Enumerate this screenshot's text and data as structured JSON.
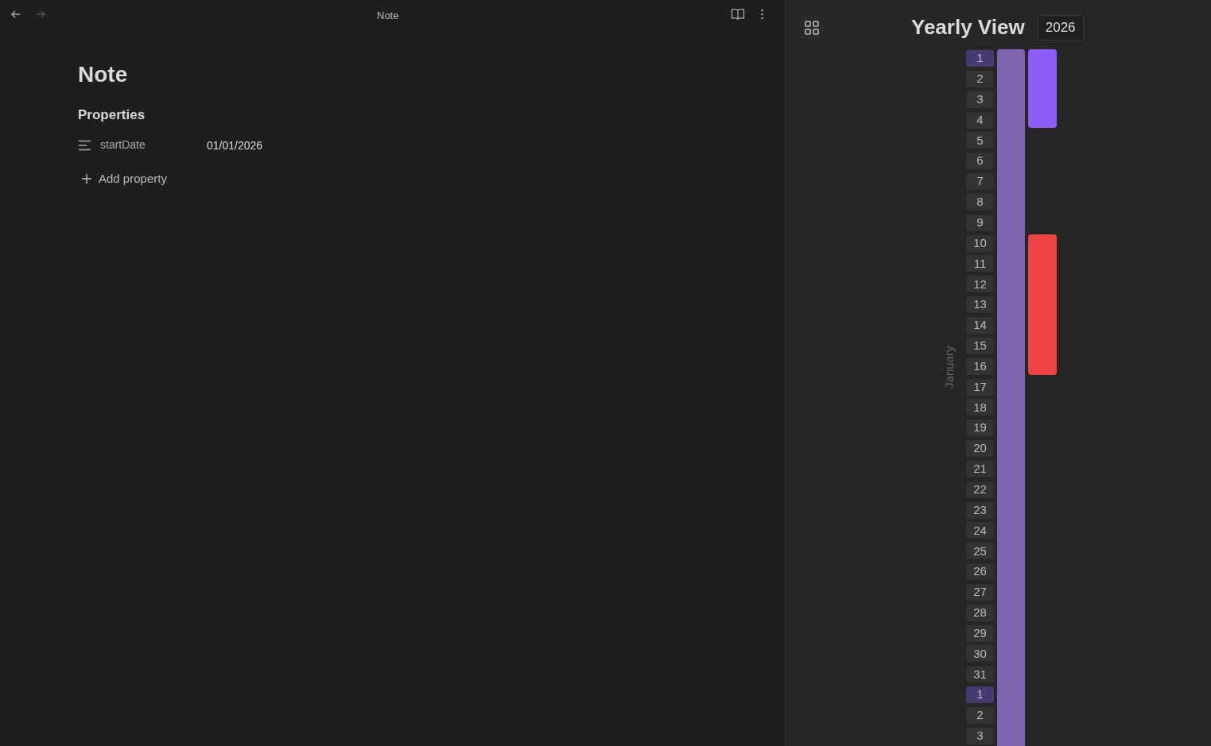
{
  "tab_header": {
    "title": "Note"
  },
  "note": {
    "title": "Note",
    "properties_heading": "Properties",
    "properties": [
      {
        "key": "startDate",
        "value": "01/01/2026"
      }
    ],
    "add_property": "Add property"
  },
  "yearly_view": {
    "title": "Yearly View",
    "year": "2026",
    "months": [
      {
        "label": "January",
        "days": [
          {
            "label": "1",
            "highlighted": true,
            "events": [
              {
                "color": "#7e64b0"
              },
              {
                "color": "#8b5cf6"
              }
            ]
          },
          {
            "label": "2",
            "highlighted": false,
            "events": [
              {
                "color": "#7e64b0"
              },
              {
                "color": "#8b5cf6"
              }
            ]
          },
          {
            "label": "3",
            "highlighted": false,
            "events": [
              {
                "color": "#7e64b0"
              },
              {
                "color": "#8b5cf6"
              }
            ]
          },
          {
            "label": "4",
            "highlighted": false,
            "events": [
              {
                "color": "#7e64b0"
              },
              {
                "color": "#8b5cf6"
              }
            ]
          },
          {
            "label": "5",
            "highlighted": false,
            "events": [
              {
                "color": "#7e64b0"
              }
            ]
          },
          {
            "label": "6",
            "highlighted": false,
            "events": [
              {
                "color": "#7e64b0"
              }
            ]
          },
          {
            "label": "7",
            "highlighted": false,
            "events": [
              {
                "color": "#7e64b0"
              }
            ]
          },
          {
            "label": "8",
            "highlighted": false,
            "events": [
              {
                "color": "#7e64b0"
              }
            ]
          },
          {
            "label": "9",
            "highlighted": false,
            "events": [
              {
                "color": "#7e64b0"
              }
            ]
          },
          {
            "label": "10",
            "highlighted": false,
            "events": [
              {
                "color": "#7e64b0"
              },
              {
                "color": "#ef4444"
              }
            ]
          },
          {
            "label": "11",
            "highlighted": false,
            "events": [
              {
                "color": "#7e64b0"
              },
              {
                "color": "#ef4444"
              }
            ]
          },
          {
            "label": "12",
            "highlighted": false,
            "events": [
              {
                "color": "#7e64b0"
              },
              {
                "color": "#ef4444"
              }
            ]
          },
          {
            "label": "13",
            "highlighted": false,
            "events": [
              {
                "color": "#7e64b0"
              },
              {
                "color": "#ef4444"
              }
            ]
          },
          {
            "label": "14",
            "highlighted": false,
            "events": [
              {
                "color": "#7e64b0"
              },
              {
                "color": "#ef4444"
              }
            ]
          },
          {
            "label": "15",
            "highlighted": false,
            "events": [
              {
                "color": "#7e64b0"
              },
              {
                "color": "#ef4444"
              }
            ]
          },
          {
            "label": "16",
            "highlighted": false,
            "events": [
              {
                "color": "#7e64b0"
              },
              {
                "color": "#ef4444"
              }
            ]
          },
          {
            "label": "17",
            "highlighted": false,
            "events": [
              {
                "color": "#7e64b0"
              }
            ]
          },
          {
            "label": "18",
            "highlighted": false,
            "events": [
              {
                "color": "#7e64b0"
              }
            ]
          },
          {
            "label": "19",
            "highlighted": false,
            "events": [
              {
                "color": "#7e64b0"
              }
            ]
          },
          {
            "label": "20",
            "highlighted": false,
            "events": [
              {
                "color": "#7e64b0"
              }
            ]
          },
          {
            "label": "21",
            "highlighted": false,
            "events": [
              {
                "color": "#7e64b0"
              }
            ]
          },
          {
            "label": "22",
            "highlighted": false,
            "events": [
              {
                "color": "#7e64b0"
              }
            ]
          },
          {
            "label": "23",
            "highlighted": false,
            "events": [
              {
                "color": "#7e64b0"
              }
            ]
          },
          {
            "label": "24",
            "highlighted": false,
            "events": [
              {
                "color": "#7e64b0"
              }
            ]
          },
          {
            "label": "25",
            "highlighted": false,
            "events": [
              {
                "color": "#7e64b0"
              }
            ]
          },
          {
            "label": "26",
            "highlighted": false,
            "events": [
              {
                "color": "#7e64b0"
              }
            ]
          },
          {
            "label": "27",
            "highlighted": false,
            "events": [
              {
                "color": "#7e64b0"
              }
            ]
          },
          {
            "label": "28",
            "highlighted": false,
            "events": [
              {
                "color": "#7e64b0"
              }
            ]
          },
          {
            "label": "29",
            "highlighted": false,
            "events": [
              {
                "color": "#7e64b0"
              }
            ]
          },
          {
            "label": "30",
            "highlighted": false,
            "events": [
              {
                "color": "#7e64b0"
              }
            ]
          },
          {
            "label": "31",
            "highlighted": false,
            "events": [
              {
                "color": "#7e64b0"
              }
            ]
          }
        ]
      },
      {
        "days": [
          {
            "label": "1",
            "highlighted": true,
            "events": [
              {
                "color": "#7e64b0"
              }
            ]
          },
          {
            "label": "2",
            "highlighted": false,
            "events": [
              {
                "color": "#7e64b0"
              }
            ]
          },
          {
            "label": "3",
            "highlighted": false,
            "events": [
              {
                "color": "#7e64b0"
              }
            ]
          }
        ]
      }
    ]
  }
}
